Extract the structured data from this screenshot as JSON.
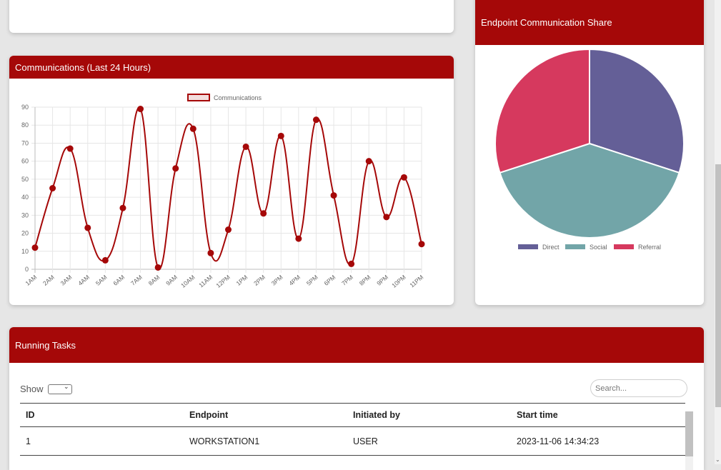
{
  "comm_card": {
    "title": "Communications (Last 24 Hours)"
  },
  "share_card": {
    "title": "Endpoint Communication Share"
  },
  "tasks_card": {
    "title": "Running Tasks",
    "show_label": "Show",
    "search_placeholder": "Search...",
    "columns": [
      "ID",
      "Endpoint",
      "Initiated by",
      "Start time"
    ],
    "rows": [
      {
        "id": "1",
        "endpoint": "WORKSTATION1",
        "initiated_by": "USER",
        "start_time": "2023-11-06 14:34:23"
      }
    ]
  },
  "colors": {
    "accent": "#a50808",
    "line": "#a50808",
    "pie": [
      "#645f97",
      "#72a5a8",
      "#d6395e"
    ]
  },
  "chart_data": [
    {
      "type": "line",
      "series": [
        {
          "name": "Communications",
          "values": [
            12,
            45,
            67,
            23,
            5,
            34,
            89,
            1,
            56,
            78,
            9,
            22,
            68,
            31,
            74,
            17,
            83,
            41,
            3,
            60,
            29,
            51,
            14
          ]
        }
      ],
      "categories": [
        "1AM",
        "2AM",
        "3AM",
        "4AM",
        "5AM",
        "6AM",
        "7AM",
        "8AM",
        "9AM",
        "10AM",
        "11AM",
        "12PM",
        "1PM",
        "2PM",
        "3PM",
        "4PM",
        "5PM",
        "6PM",
        "7PM",
        "8PM",
        "9PM",
        "10PM",
        "11PM"
      ],
      "yticks": [
        "0",
        "10",
        "20",
        "30",
        "40",
        "50",
        "60",
        "70",
        "80",
        "90"
      ],
      "ylim": [
        0,
        90
      ],
      "grid": true,
      "legend": "top-center"
    },
    {
      "type": "pie",
      "categories": [
        "Direct",
        "Social",
        "Referral"
      ],
      "values": [
        30,
        40,
        30
      ],
      "legend": "bottom"
    }
  ]
}
